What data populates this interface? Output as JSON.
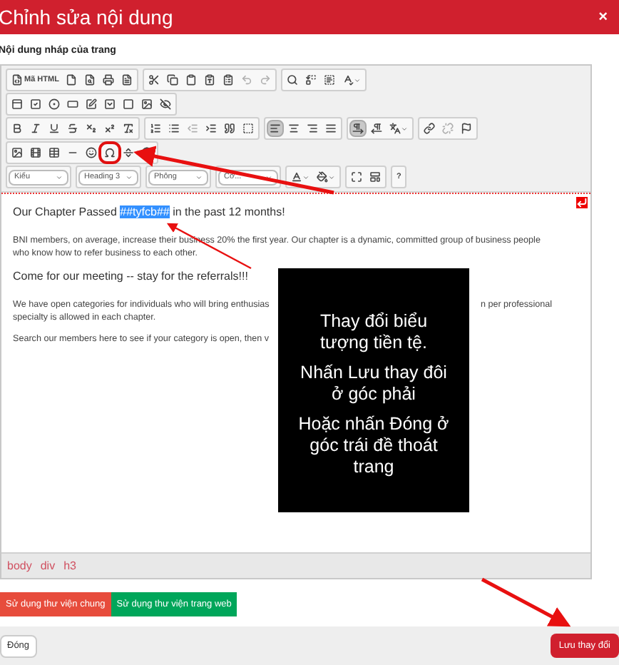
{
  "dialog": {
    "title": "Chỉnh sửa nội dung",
    "close": "×"
  },
  "field_label": "Nội dung nháp của trang",
  "toolbar": {
    "rows": [
      [
        [
          {
            "kind": "text",
            "label": "Mã HTML"
          },
          {
            "kind": "icon"
          },
          {
            "kind": "icon"
          },
          {
            "kind": "icon"
          },
          {
            "kind": "icon"
          }
        ],
        [
          {
            "kind": "icon"
          },
          {
            "kind": "icon"
          },
          {
            "kind": "icon"
          },
          {
            "kind": "icon"
          },
          {
            "kind": "icon"
          },
          {
            "kind": "icon",
            "disabled": true
          },
          {
            "kind": "icon",
            "disabled": true
          }
        ],
        [
          {
            "kind": "icon"
          },
          {
            "kind": "icon"
          },
          {
            "kind": "icon"
          },
          {
            "kind": "menu"
          }
        ]
      ],
      [
        [
          {
            "kind": "icon"
          },
          {
            "kind": "icon"
          },
          {
            "kind": "icon"
          },
          {
            "kind": "icon"
          },
          {
            "kind": "icon"
          },
          {
            "kind": "icon"
          },
          {
            "kind": "icon"
          },
          {
            "kind": "icon"
          },
          {
            "kind": "icon"
          }
        ]
      ],
      [
        [
          {
            "kind": "icon"
          },
          {
            "kind": "icon"
          },
          {
            "kind": "icon"
          },
          {
            "kind": "icon"
          },
          {
            "kind": "icon"
          },
          {
            "kind": "icon"
          },
          {
            "kind": "icon"
          }
        ],
        [
          {
            "kind": "icon"
          },
          {
            "kind": "icon"
          },
          {
            "kind": "icon",
            "disabled": true
          },
          {
            "kind": "icon"
          },
          {
            "kind": "icon"
          },
          {
            "kind": "icon"
          }
        ],
        [
          {
            "kind": "icon",
            "active": true
          },
          {
            "kind": "icon"
          },
          {
            "kind": "icon"
          },
          {
            "kind": "icon"
          }
        ],
        [
          {
            "kind": "icon",
            "active": true
          },
          {
            "kind": "icon"
          },
          {
            "kind": "menu"
          }
        ],
        [
          {
            "kind": "icon"
          },
          {
            "kind": "icon",
            "disabled": true
          },
          {
            "kind": "icon"
          }
        ]
      ],
      [
        [
          {
            "kind": "icon"
          },
          {
            "kind": "icon"
          },
          {
            "kind": "icon"
          },
          {
            "kind": "icon"
          },
          {
            "kind": "icon"
          },
          {
            "kind": "icon",
            "highlighted": true
          },
          {
            "kind": "icon"
          },
          {
            "kind": "icon"
          }
        ]
      ],
      [
        [
          {
            "kind": "combo",
            "label": "Kiểu"
          }
        ],
        [
          {
            "kind": "combo",
            "label": "Heading 3"
          }
        ],
        [
          {
            "kind": "combo",
            "label": "Phông"
          }
        ],
        [
          {
            "kind": "combo",
            "label": "Cỡ..."
          }
        ],
        [
          {
            "kind": "menu"
          },
          {
            "kind": "menu"
          }
        ],
        [
          {
            "kind": "icon"
          },
          {
            "kind": "icon"
          }
        ],
        [
          {
            "kind": "text",
            "label": "?"
          }
        ]
      ]
    ]
  },
  "content": {
    "blocks": [
      {
        "kind": "heading",
        "parts": [
          {
            "text": "Our Chapter Passed ",
            "selected": false
          },
          {
            "text": "##tyfcb##",
            "selected": true
          },
          {
            "text": " in the past 12 months!",
            "selected": false
          }
        ]
      },
      {
        "kind": "paragraph",
        "lines": [
          [
            "BNI members, on average, increase their business 20% the first year. Our chapter is a dynamic, committed group of business people"
          ],
          [
            "who know how to refer business to each other."
          ]
        ]
      },
      {
        "kind": "heading",
        "parts": [
          {
            "text": "Come for our meeting -- stay for the referrals!!!",
            "selected": false
          }
        ]
      },
      {
        "kind": "paragraph",
        "lines": [
          [
            "We have open categories for individuals who will bring enthusias",
            "n per professional"
          ],
          [
            "specialty is allowed in each chapter."
          ]
        ]
      },
      {
        "kind": "paragraph",
        "lines": [
          [
            "Search our members here to see if your category is open, then v"
          ]
        ]
      }
    ]
  },
  "elements_path": [
    "body",
    "div",
    "h3"
  ],
  "library_buttons": [
    {
      "label": "Sử dụng thư viện chung",
      "color": "#e74c3c"
    },
    {
      "label": "Sử dụng thư viện trang web",
      "color": "#00a65a"
    }
  ],
  "footer": {
    "close": "Đóng",
    "save": "Lưu thay đổi"
  },
  "note": {
    "paragraphs": [
      "Thay đổi biểu tượng tiền tệ.",
      "Nhấn Lưu thay đôi ở góc phải",
      "Hoặc nhấn Đóng ở góc trái đề thoát trang"
    ]
  }
}
